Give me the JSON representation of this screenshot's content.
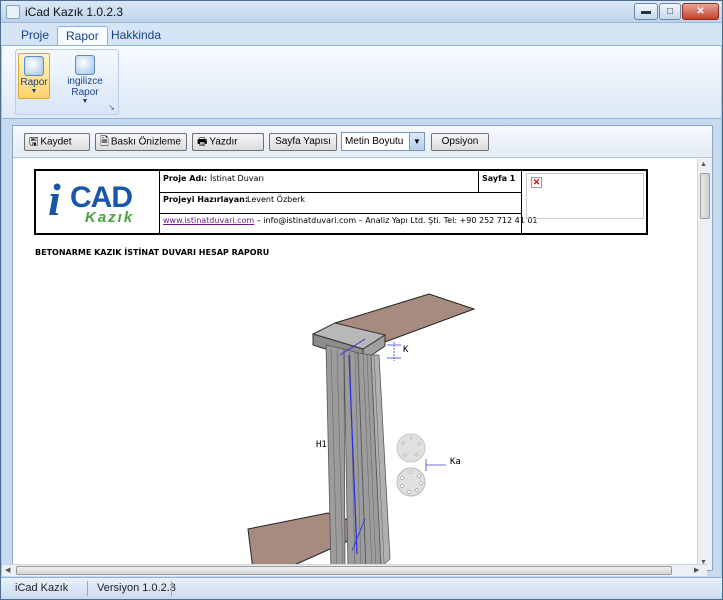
{
  "window": {
    "title": "iCad Kazık 1.0.2.3",
    "minimize": "▬",
    "maximize": "□",
    "close": "✕"
  },
  "ribbon": {
    "tabs": [
      "Proje",
      "Rapor",
      "Hakkinda"
    ],
    "buttons": [
      {
        "label": "Rapor",
        "selected": true
      },
      {
        "label": "ingilizce Rapor",
        "selected": false
      }
    ],
    "group_launcher": "↘"
  },
  "toolbar": {
    "save": "Kaydet",
    "preview": "Baskı Önizleme",
    "print": "Yazdır",
    "page_setup": "Sayfa Yapısı",
    "text_size": "Metin Boyutu",
    "options": "Opsiyon"
  },
  "report": {
    "logo": {
      "i": "i",
      "cad": "CAD",
      "kazik": "Kazık"
    },
    "project_label": "Proje Adı:",
    "project_name": "İstinat Duvarı",
    "page_label": "Sayfa 1",
    "prepared_label": "Projeyi Hazırlayan:",
    "prepared_by": "Levent Özberk",
    "website": "www.istinatduvari.com",
    "contact": " – info@istinatduvari.com – Analiz Yapı Ltd. Şti. Tel: +90 252 712 41 01",
    "broken_image_icon": "✕",
    "title": "BETONARME KAZIK İSTİNAT DUVARI HESAP RAPORU",
    "figure_labels": {
      "k": "K",
      "h1": "H1",
      "ka": "Ka"
    }
  },
  "statusbar": {
    "app": "iCad Kazık",
    "version": "Versiyon 1.0.2.3"
  },
  "colors": {
    "brand_blue": "#1a56a8",
    "brand_green": "#48a23e",
    "ribbon_bg": "#dde9f7",
    "link": "#6b1a8a"
  }
}
